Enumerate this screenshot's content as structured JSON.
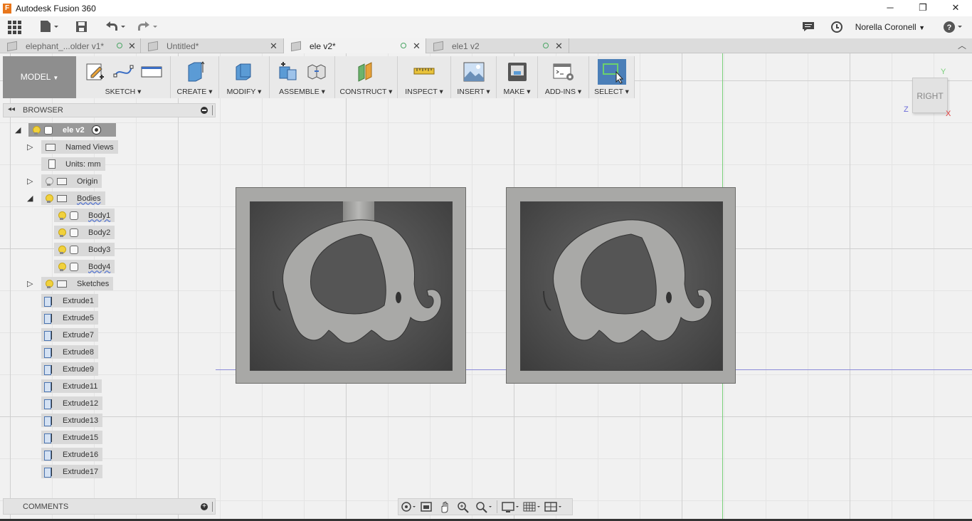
{
  "window": {
    "title": "Autodesk Fusion 360",
    "app_icon_letter": "F",
    "minimize": "─",
    "restore": "❐",
    "close": "✕"
  },
  "quick_access": {
    "user_name": "Norella Coronell",
    "icons": [
      "app-grid-icon",
      "file-icon",
      "save-icon",
      "undo-icon",
      "redo-icon",
      "notifications-icon",
      "job-status-icon",
      "help-icon"
    ]
  },
  "tabs": [
    {
      "label": "elephant_...older v1*",
      "active": false
    },
    {
      "label": "Untitled*",
      "active": false
    },
    {
      "label": "ele v2*",
      "active": true
    },
    {
      "label": "ele1 v2",
      "active": false
    }
  ],
  "toolbar": {
    "workspace": "MODEL",
    "groups": [
      {
        "label": "SKETCH"
      },
      {
        "label": "CREATE"
      },
      {
        "label": "MODIFY"
      },
      {
        "label": "ASSEMBLE"
      },
      {
        "label": "CONSTRUCT"
      },
      {
        "label": "INSPECT"
      },
      {
        "label": "INSERT"
      },
      {
        "label": "MAKE"
      },
      {
        "label": "ADD-INS"
      },
      {
        "label": "SELECT"
      }
    ]
  },
  "browser": {
    "title": "BROWSER",
    "root": "ele v2",
    "named_views": "Named Views",
    "units": "Units: mm",
    "origin": "Origin",
    "bodies": "Bodies",
    "body_items": [
      "Body1",
      "Body2",
      "Body3",
      "Body4"
    ],
    "sketches": "Sketches",
    "features": [
      "Extrude1",
      "Extrude5",
      "Extrude7",
      "Extrude8",
      "Extrude9",
      "Extrude11",
      "Extrude12",
      "Extrude13",
      "Extrude15",
      "Extrude16",
      "Extrude17"
    ]
  },
  "comments": {
    "title": "COMMENTS"
  },
  "viewcube": {
    "face": "RIGHT",
    "axis_z": "Z",
    "axis_y": "Y",
    "axis_x": "X"
  },
  "colors": {
    "accent": "#4b7fb8",
    "axis_x": "#e04040",
    "axis_y": "#7ad07a",
    "axis_z": "#6a6ad8"
  }
}
